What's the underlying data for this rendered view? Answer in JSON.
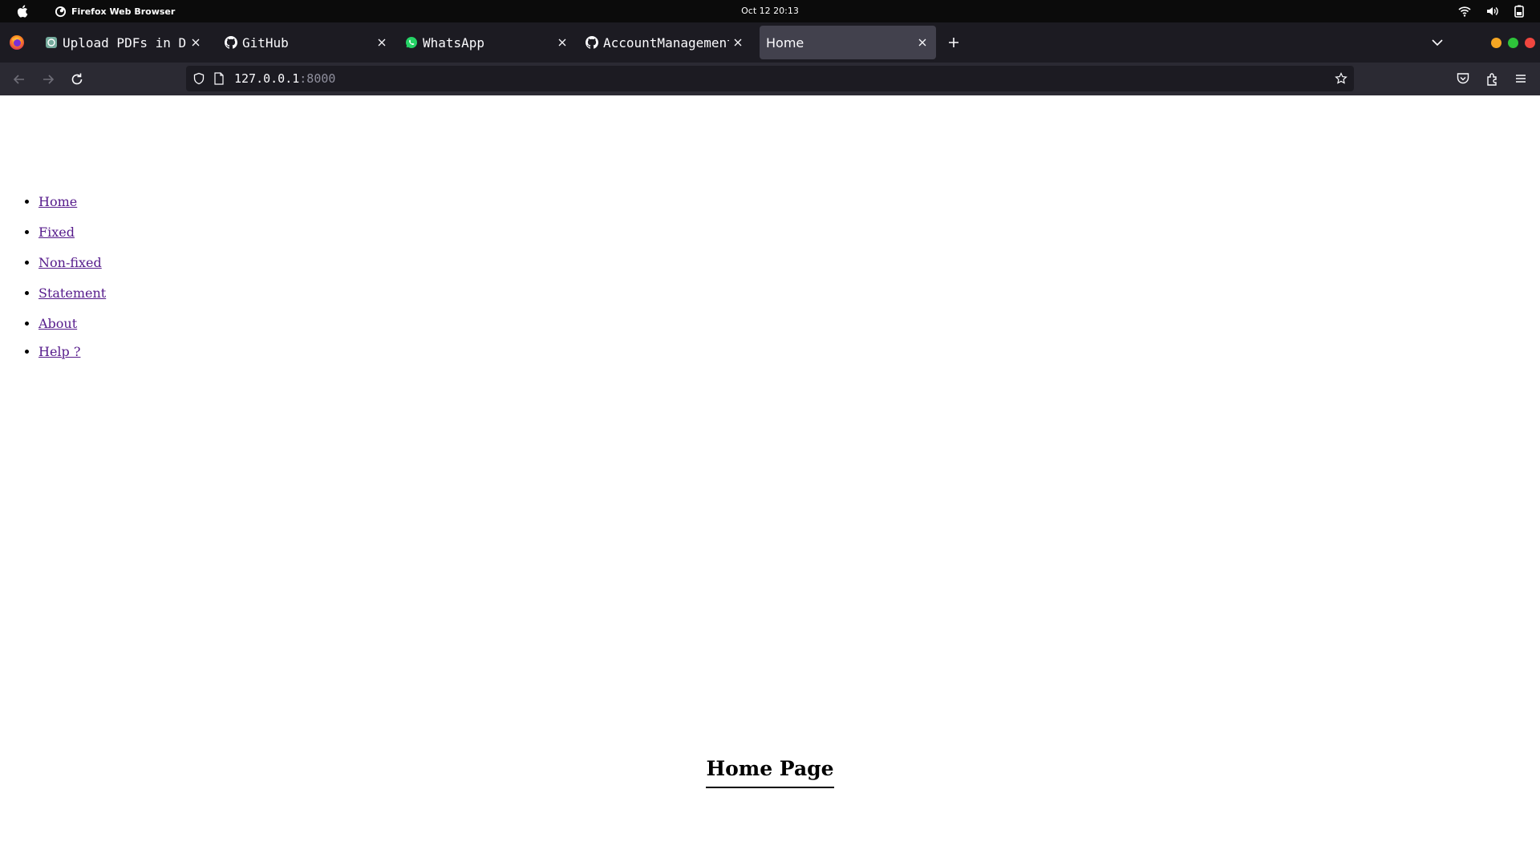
{
  "os": {
    "app_name": "Firefox Web Browser",
    "clock": "Oct 12  20:13"
  },
  "tabs": [
    {
      "title": "Upload PDFs in Dja",
      "favicon": "chatgpt-icon",
      "active": false
    },
    {
      "title": "GitHub",
      "favicon": "github-icon",
      "active": false
    },
    {
      "title": "WhatsApp",
      "favicon": "whatsapp-icon",
      "active": false
    },
    {
      "title": "AccountManagement/",
      "favicon": "github-icon",
      "active": false
    },
    {
      "title": "Home",
      "favicon": "",
      "active": true
    }
  ],
  "urlbar": {
    "host": "127.0.0.1",
    "port": ":8000"
  },
  "nav": {
    "items": [
      "Home",
      "Fixed",
      "Non-fixed",
      "Statement",
      "About",
      "Help ?"
    ]
  },
  "main": {
    "title": "Home Page"
  },
  "colors": {
    "link_visited": "#551a8b",
    "tab_active": "#42414d",
    "tabbar_bg": "#1c1b22",
    "navbar_bg": "#2b2a33",
    "win_min": "#f5a623",
    "win_max": "#2ec43a",
    "win_close": "#f0463f"
  }
}
